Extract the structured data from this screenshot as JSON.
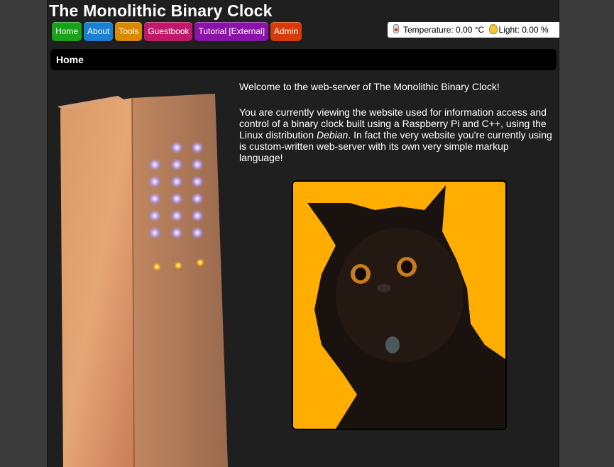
{
  "site": {
    "title": "The Monolithic Binary Clock"
  },
  "nav": [
    {
      "label": "Home",
      "color": "#1aa11a"
    },
    {
      "label": "About",
      "color": "#1a7fd1"
    },
    {
      "label": "Tools",
      "color": "#d98a00"
    },
    {
      "label": "Guestbook",
      "color": "#c0186a"
    },
    {
      "label": "Tutorial [External]",
      "color": "#8a14a8"
    },
    {
      "label": "Admin",
      "color": "#d83b0a"
    }
  ],
  "status": {
    "temperature_label": "Temperature:",
    "temperature_value": "0.00 °C",
    "light_label": "Light:",
    "light_value": "0.00 %",
    "temperature_icon": "thermometer-icon",
    "light_icon": "lightbulb-icon"
  },
  "page": {
    "heading": "Home"
  },
  "content": {
    "welcome": "Welcome to the web-server of The Monolithic Binary Clock!",
    "intro_part1": "You are currently viewing the website used for information access and control of a binary clock built using a Raspberry Pi and C++, using the Linux distribution ",
    "intro_em": "Debian",
    "intro_part2": ". In fact the very website you're currently using is custom-written web-server with its own very simple markup language!"
  },
  "theme": {
    "page_background": "#3a3a3a",
    "panel_background": "#1f1f1f",
    "cat_background": "#ffad00"
  }
}
